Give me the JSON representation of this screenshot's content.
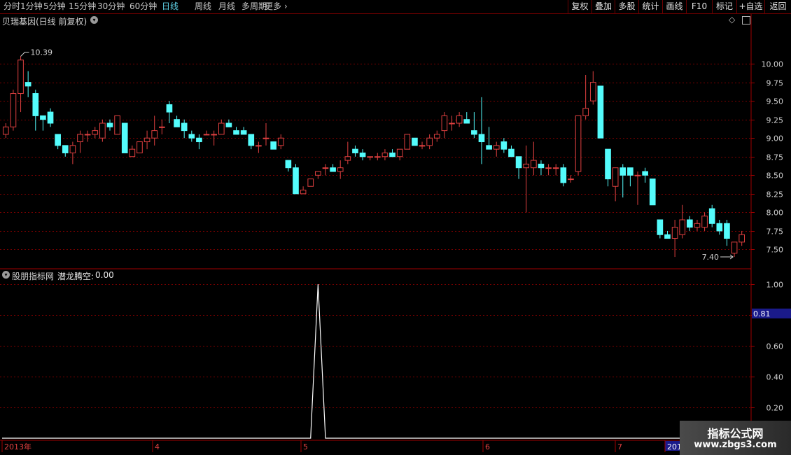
{
  "toolbar": {
    "periods": [
      "分时",
      "1分钟",
      "5分钟",
      "15分钟",
      "30分钟",
      "60分钟",
      "日线",
      "周线",
      "月线",
      "多周期",
      "更多"
    ],
    "active_period": "日线",
    "right_buttons": [
      "复权",
      "叠加",
      "多股",
      "统计",
      "画线",
      "F10",
      "标记",
      "+自选",
      "返回"
    ]
  },
  "main_chart": {
    "title": "贝瑞基因(日线 前复权)",
    "max_label": "10.39",
    "min_label": "7.40",
    "y_ticks": [
      "10.00",
      "9.75",
      "9.50",
      "9.25",
      "9.00",
      "8.75",
      "8.50",
      "8.25",
      "8.00",
      "7.75",
      "7.50"
    ]
  },
  "indicator": {
    "title": "股朋指标网",
    "name": "潜龙腾空:",
    "value": "0.00",
    "y_ticks": [
      "1.00",
      "0.80",
      "0.60",
      "0.40",
      "0.20"
    ],
    "current_value": "0.81"
  },
  "x_axis": {
    "labels": [
      "2013年",
      "4",
      "5",
      "6",
      "7",
      "201"
    ]
  },
  "watermark": {
    "line1": "指标公式网",
    "line2": "www.zbgs3.com"
  },
  "colors": {
    "up": "#e04040",
    "down": "#54fcfc",
    "grid": "#7a0000",
    "axis": "#a00000",
    "indicator_line": "#ffffff",
    "value_box": "#1a1a8a"
  },
  "chart_data": [
    {
      "type": "candlestick",
      "title": "贝瑞基因(日线 前复权)",
      "ylim": [
        7.25,
        10.5
      ],
      "y_ticks": [
        10.0,
        9.75,
        9.5,
        9.25,
        9.0,
        8.75,
        8.5,
        8.25,
        8.0,
        7.75,
        7.5
      ],
      "x_labels": [
        "2013年",
        "4",
        "5",
        "6",
        "7"
      ],
      "ohlc": [
        [
          9.05,
          9.2,
          9.0,
          9.15
        ],
        [
          9.15,
          9.65,
          9.1,
          9.6
        ],
        [
          9.6,
          10.1,
          9.35,
          10.05
        ],
        [
          9.75,
          9.9,
          9.55,
          9.7
        ],
        [
          9.6,
          9.65,
          9.1,
          9.3
        ],
        [
          9.3,
          9.25,
          9.1,
          9.25
        ],
        [
          9.35,
          9.4,
          9.15,
          9.2
        ],
        [
          9.05,
          9.05,
          8.85,
          8.9
        ],
        [
          8.9,
          8.9,
          8.75,
          8.8
        ],
        [
          8.8,
          8.95,
          8.65,
          8.9
        ],
        [
          8.95,
          9.1,
          8.8,
          9.05
        ],
        [
          9.05,
          9.1,
          8.95,
          9.05
        ],
        [
          9.05,
          9.15,
          9.0,
          9.1
        ],
        [
          9.0,
          9.25,
          8.95,
          9.2
        ],
        [
          9.2,
          9.25,
          9.1,
          9.15
        ],
        [
          9.05,
          9.3,
          9.05,
          9.3
        ],
        [
          9.2,
          9.2,
          8.8,
          8.8
        ],
        [
          8.75,
          8.9,
          8.75,
          8.85
        ],
        [
          8.8,
          8.95,
          8.8,
          8.95
        ],
        [
          8.95,
          9.1,
          8.85,
          9.0
        ],
        [
          9.0,
          9.3,
          8.9,
          9.1
        ],
        [
          9.15,
          9.25,
          9.05,
          9.15
        ],
        [
          9.45,
          9.5,
          9.2,
          9.35
        ],
        [
          9.25,
          9.3,
          9.15,
          9.15
        ],
        [
          9.2,
          9.25,
          9.0,
          9.1
        ],
        [
          9.05,
          9.1,
          8.95,
          9.0
        ],
        [
          9.0,
          9.05,
          8.85,
          8.95
        ],
        [
          9.05,
          9.1,
          9.05,
          9.05
        ],
        [
          9.05,
          9.1,
          8.9,
          9.05
        ],
        [
          9.05,
          9.25,
          9.05,
          9.2
        ],
        [
          9.2,
          9.25,
          9.15,
          9.15
        ],
        [
          9.1,
          9.15,
          9.05,
          9.05
        ],
        [
          9.1,
          9.15,
          9.05,
          9.05
        ],
        [
          9.05,
          9.05,
          8.85,
          8.9
        ],
        [
          8.9,
          8.95,
          8.8,
          8.9
        ],
        [
          9.0,
          9.2,
          8.9,
          9.0
        ],
        [
          8.95,
          8.95,
          8.85,
          8.85
        ],
        [
          8.9,
          9.05,
          8.85,
          9.0
        ],
        [
          8.7,
          8.7,
          8.55,
          8.6
        ],
        [
          8.6,
          8.65,
          8.25,
          8.25
        ],
        [
          8.25,
          8.35,
          8.25,
          8.3
        ],
        [
          8.35,
          8.45,
          8.35,
          8.45
        ],
        [
          8.5,
          8.55,
          8.45,
          8.55
        ],
        [
          8.6,
          8.65,
          8.5,
          8.6
        ],
        [
          8.6,
          8.65,
          8.55,
          8.55
        ],
        [
          8.55,
          8.7,
          8.45,
          8.6
        ],
        [
          8.7,
          8.95,
          8.65,
          8.75
        ],
        [
          8.85,
          8.9,
          8.75,
          8.8
        ],
        [
          8.8,
          8.85,
          8.7,
          8.75
        ],
        [
          8.75,
          8.75,
          8.7,
          8.75
        ],
        [
          8.75,
          8.8,
          8.7,
          8.75
        ],
        [
          8.75,
          8.85,
          8.7,
          8.8
        ],
        [
          8.8,
          8.85,
          8.75,
          8.75
        ],
        [
          8.75,
          8.85,
          8.7,
          8.85
        ],
        [
          8.85,
          9.05,
          8.85,
          9.05
        ],
        [
          9.0,
          8.95,
          8.9,
          8.9
        ],
        [
          8.9,
          8.95,
          8.85,
          8.9
        ],
        [
          8.9,
          9.05,
          8.85,
          9.0
        ],
        [
          9.0,
          9.1,
          8.95,
          9.05
        ],
        [
          9.1,
          9.35,
          9.0,
          9.3
        ],
        [
          9.2,
          9.3,
          9.1,
          9.2
        ],
        [
          9.2,
          9.35,
          9.15,
          9.3
        ],
        [
          9.25,
          9.35,
          9.2,
          9.2
        ],
        [
          9.1,
          9.35,
          9.0,
          9.05
        ],
        [
          9.05,
          9.55,
          8.65,
          8.95
        ],
        [
          8.9,
          9.15,
          8.85,
          8.85
        ],
        [
          8.85,
          8.95,
          8.75,
          8.9
        ],
        [
          8.95,
          9.0,
          8.8,
          8.85
        ],
        [
          8.85,
          8.9,
          8.75,
          8.75
        ],
        [
          8.75,
          8.75,
          8.45,
          8.6
        ],
        [
          8.6,
          8.9,
          8.0,
          8.65
        ],
        [
          8.6,
          8.95,
          8.5,
          8.7
        ],
        [
          8.65,
          8.7,
          8.5,
          8.6
        ],
        [
          8.6,
          8.65,
          8.5,
          8.6
        ],
        [
          8.6,
          8.65,
          8.5,
          8.6
        ],
        [
          8.6,
          8.65,
          8.35,
          8.4
        ],
        [
          8.45,
          8.5,
          8.4,
          8.45
        ],
        [
          8.55,
          9.3,
          8.5,
          9.3
        ],
        [
          9.3,
          9.85,
          9.25,
          9.4
        ],
        [
          9.5,
          9.9,
          9.45,
          9.75
        ],
        [
          9.7,
          9.7,
          9.05,
          9.0
        ],
        [
          8.85,
          8.85,
          8.35,
          8.45
        ],
        [
          8.35,
          8.6,
          8.15,
          8.6
        ],
        [
          8.6,
          8.65,
          8.2,
          8.5
        ],
        [
          8.6,
          8.6,
          8.35,
          8.5
        ],
        [
          8.5,
          8.55,
          8.1,
          8.5
        ],
        [
          8.55,
          8.6,
          8.4,
          8.5
        ],
        [
          8.45,
          8.45,
          8.1,
          8.1
        ],
        [
          7.9,
          7.9,
          7.65,
          7.7
        ],
        [
          7.7,
          7.75,
          7.65,
          7.65
        ],
        [
          7.65,
          7.9,
          7.4,
          7.8
        ],
        [
          7.7,
          8.1,
          7.65,
          7.9
        ],
        [
          7.9,
          7.95,
          7.75,
          7.8
        ],
        [
          7.8,
          7.9,
          7.75,
          7.85
        ],
        [
          7.8,
          8.0,
          7.75,
          7.95
        ],
        [
          8.05,
          8.1,
          7.8,
          7.85
        ],
        [
          7.85,
          7.9,
          7.7,
          7.75
        ],
        [
          7.85,
          7.9,
          7.55,
          7.65
        ],
        [
          7.45,
          7.6,
          7.4,
          7.6
        ],
        [
          7.6,
          7.75,
          7.55,
          7.7
        ]
      ]
    },
    {
      "type": "line",
      "title": "股朋指标网 潜龙腾空",
      "ylim": [
        0,
        1.05
      ],
      "y_ticks": [
        1.0,
        0.8,
        0.6,
        0.4,
        0.2
      ],
      "series": [
        {
          "name": "潜龙腾空",
          "spike_index": 42,
          "spike_value": 1.0,
          "baseline": 0.0
        }
      ]
    }
  ]
}
